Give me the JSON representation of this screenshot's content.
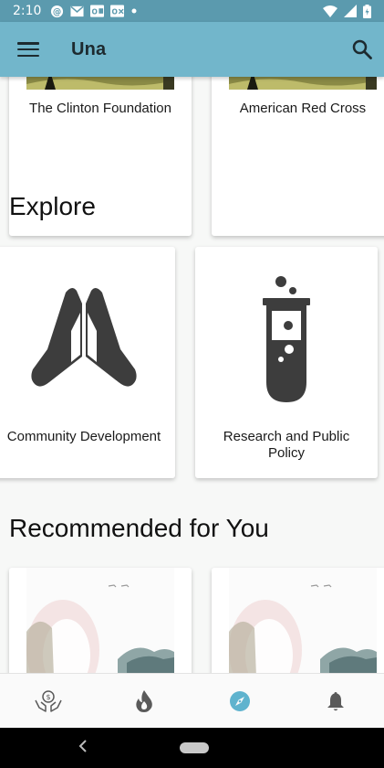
{
  "status_bar": {
    "time": "2:10",
    "notification_icons": [
      "at-sign-icon",
      "mail-icon",
      "outlook-icon",
      "outlook-calendar-icon",
      "dot-icon"
    ],
    "system_icons": [
      "wifi-icon",
      "cell-signal-icon",
      "battery-icon"
    ]
  },
  "app_bar": {
    "title": "Una",
    "menu_icon": "menu-icon",
    "search_icon": "search-icon"
  },
  "organizations": [
    {
      "name": "The Clinton Foundation"
    },
    {
      "name": "American Red Cross"
    }
  ],
  "explore": {
    "title": "Explore",
    "items": [
      {
        "label": "Community Development",
        "icon": "praying-hands-icon"
      },
      {
        "label": "Research and Public Policy",
        "icon": "test-tube-icon"
      }
    ]
  },
  "recommended": {
    "title": "Recommended for You"
  },
  "bottom_nav": {
    "items": [
      {
        "icon": "donate-hands-icon",
        "active": false
      },
      {
        "icon": "flame-icon",
        "active": false
      },
      {
        "icon": "compass-icon",
        "active": true
      },
      {
        "icon": "bell-icon",
        "active": false
      }
    ],
    "active_color": "#5fb3ce",
    "inactive_color": "#5a5a5a"
  },
  "colors": {
    "status_bar": "#5b9aae",
    "app_bar": "#72b6cb",
    "background": "#f7f8f7"
  }
}
